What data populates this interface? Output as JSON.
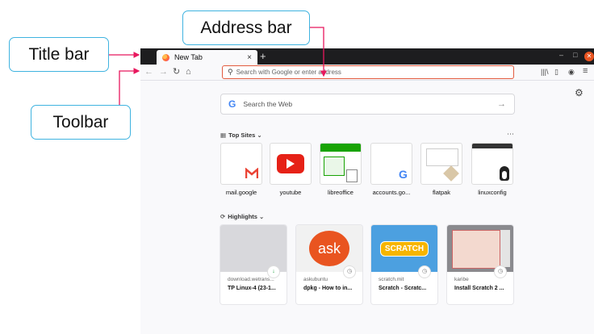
{
  "annotations": {
    "title_bar": "Title bar",
    "address_bar": "Address bar",
    "toolbar": "Toolbar"
  },
  "browser": {
    "tab_title": "New Tab",
    "tab_close": "×",
    "new_tab": "+",
    "win_min": "–",
    "win_max": "□",
    "win_close": "✕",
    "nav": {
      "back": "←",
      "forward": "→",
      "reload": "↻",
      "home": "⌂"
    },
    "url_placeholder": "Search with Google or enter address",
    "toolbar_icons": {
      "library": "|||\\",
      "sidebar": "▯",
      "account": "◉",
      "menu": "≡"
    }
  },
  "newtab": {
    "search_text": "Search the Web",
    "search_arrow": "→",
    "top_sites_label": "Top Sites",
    "highlights_label": "Highlights",
    "top_sites": [
      "mail.google",
      "youtube",
      "libreoffice",
      "accounts.go...",
      "flatpak",
      "linuxconfig"
    ],
    "highlights": [
      {
        "source": "download.wetrans...",
        "title": "TP Linux-4 (23-1..."
      },
      {
        "source": "askubuntu",
        "title": "dpkg - How to in...",
        "logo_text": "ask"
      },
      {
        "source": "scratch.mit",
        "title": "Scratch - Scratc...",
        "logo_text": "SCRATCH"
      },
      {
        "source": "karibe",
        "title": "Install Scratch 2 ..."
      }
    ]
  },
  "colors": {
    "callout_border": "#3fb3e0",
    "arrow": "#e8175d",
    "accent": "#e25b3f"
  }
}
